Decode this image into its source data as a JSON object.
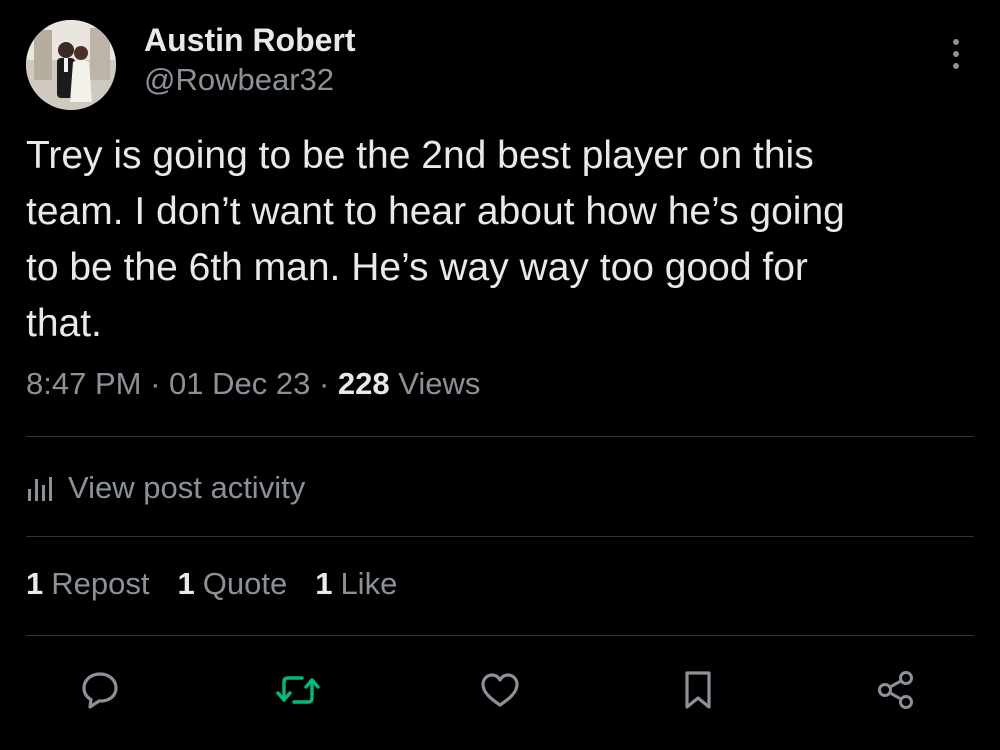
{
  "author": {
    "display_name": "Austin Robert",
    "handle": "@Rowbear32",
    "avatar_icon": "profile-photo-couple"
  },
  "post": {
    "text": "Trey is going to be the 2nd best player on this\nteam. I don’t want to hear about how he’s going\nto be the 6th man. He’s way way too good for\nthat."
  },
  "meta": {
    "time": "8:47 PM",
    "sep1": " · ",
    "date": "01 Dec 23",
    "sep2": " · ",
    "views_count": "228",
    "views_label": " Views"
  },
  "activity": {
    "label": "View post activity",
    "icon": "bar-chart-icon"
  },
  "counts": {
    "reposts": {
      "num": "1",
      "label": "Repost"
    },
    "quotes": {
      "num": "1",
      "label": "Quote"
    },
    "likes": {
      "num": "1",
      "label": "Like"
    }
  },
  "actions": [
    {
      "icon": "reply-icon",
      "color": "#8b9199"
    },
    {
      "icon": "repost-icon",
      "color": "#00ba7c"
    },
    {
      "icon": "like-icon",
      "color": "#8b9199"
    },
    {
      "icon": "bookmark-icon",
      "color": "#8b9199"
    },
    {
      "icon": "share-icon",
      "color": "#8b9199"
    }
  ],
  "colors": {
    "background": "#000000",
    "text_primary": "#e7e9ea",
    "text_secondary": "#8b9199",
    "divider": "#2f3336",
    "repost_active": "#00ba7c"
  }
}
